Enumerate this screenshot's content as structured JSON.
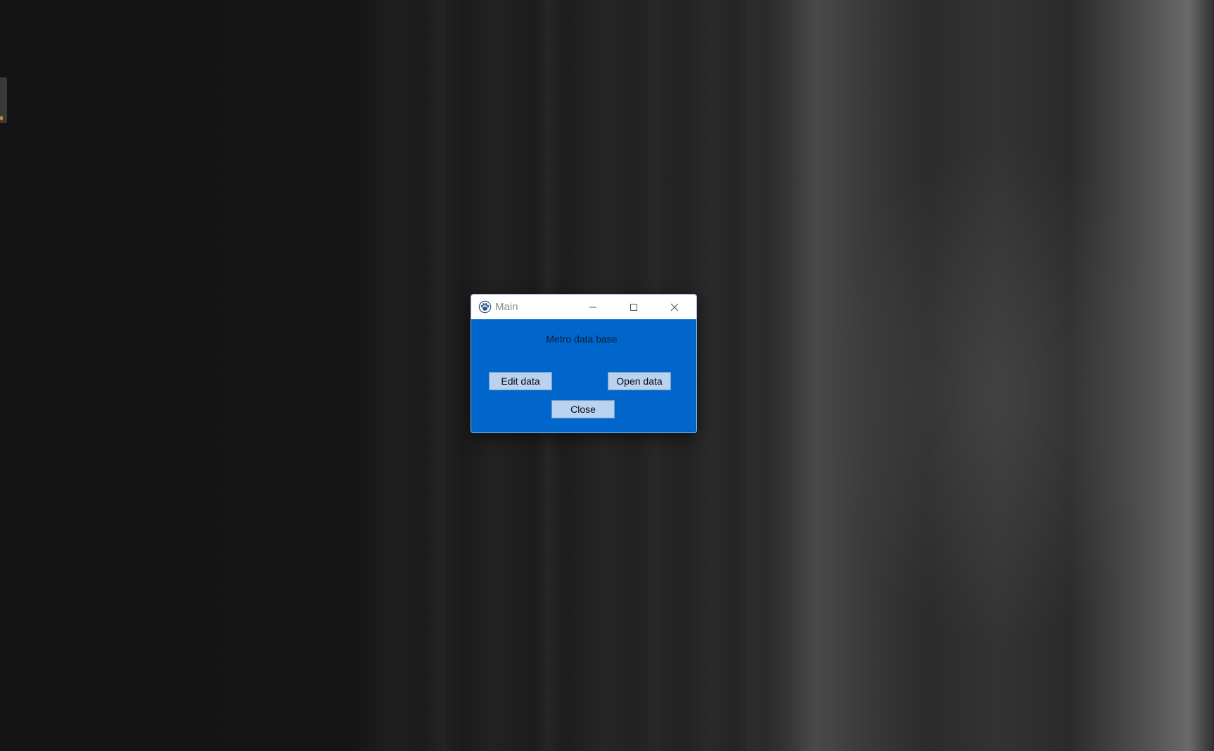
{
  "window": {
    "title": "Main",
    "app_icon": "paw-icon",
    "controls": {
      "minimize_icon": "minimize-icon",
      "maximize_icon": "maximize-icon",
      "close_icon": "close-icon"
    }
  },
  "content": {
    "heading": "Metro data base",
    "buttons": {
      "edit": "Edit data",
      "open": "Open data",
      "close": "Close"
    }
  },
  "colors": {
    "window_background": "#0066cc",
    "button_background": "#b9d2f0",
    "titlebar_background": "#ffffff"
  }
}
